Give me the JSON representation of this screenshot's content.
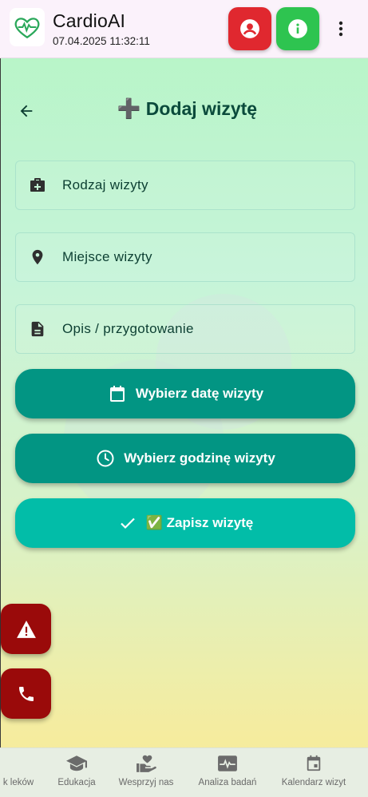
{
  "app": {
    "title": "CardioAI",
    "datetime": "07.04.2025 11:32:11"
  },
  "header": {
    "profile_icon": "account-circle-icon",
    "info_icon": "info-icon",
    "more_icon": "more-vert-icon"
  },
  "page": {
    "title_emoji": "➕",
    "title": "Dodaj wizytę"
  },
  "fields": {
    "visit_type": "Rodzaj wizyty",
    "visit_place": "Miejsce wizyty",
    "description": "Opis / przygotowanie"
  },
  "actions": {
    "pick_date": "Wybierz datę wizyty",
    "pick_time": "Wybierz godzinę wizyty",
    "save": "✅ Zapisz wizytę"
  },
  "nav": {
    "items": [
      {
        "label": "k leków",
        "icon": "pill-icon"
      },
      {
        "label": "Edukacja",
        "icon": "school-icon"
      },
      {
        "label": "Wesprzyj nas",
        "icon": "volunteer-icon"
      },
      {
        "label": "Analiza badań",
        "icon": "monitor-heart-icon"
      },
      {
        "label": "Kalendarz wizyt",
        "icon": "event-icon"
      }
    ]
  },
  "colors": {
    "accent": "#029583",
    "save": "#02bda8",
    "danger": "#9a0a0a",
    "profile": "#e0282f",
    "info": "#2ec450",
    "title": "#0a4a3b"
  }
}
